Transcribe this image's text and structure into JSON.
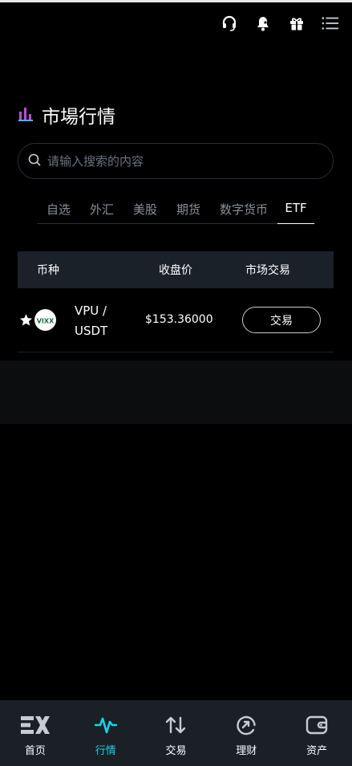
{
  "header": {
    "icons": [
      "headset-icon",
      "bell-icon",
      "gift-icon",
      "menu-icon"
    ]
  },
  "section": {
    "title": "市場行情",
    "icon": "bar-chart-icon"
  },
  "search": {
    "placeholder": "请输入搜索的内容",
    "value": ""
  },
  "tabs": [
    {
      "label": "自选",
      "active": false
    },
    {
      "label": "外汇",
      "active": false
    },
    {
      "label": "美股",
      "active": false
    },
    {
      "label": "期货",
      "active": false
    },
    {
      "label": "数字货币",
      "active": false
    },
    {
      "label": "ETF",
      "active": true
    }
  ],
  "table": {
    "headers": [
      "币种",
      "收盘价",
      "市场交易"
    ],
    "rows": [
      {
        "pair_line1": "VPU /",
        "pair_line2": "USDT",
        "price": "$153.36000",
        "action": "交易",
        "logo_text": "VIXX",
        "favorite": true
      }
    ]
  },
  "nav": {
    "items": [
      {
        "label": "首页",
        "icon": "ex-logo-icon",
        "active": false
      },
      {
        "label": "行情",
        "icon": "pulse-icon",
        "active": true
      },
      {
        "label": "交易",
        "icon": "swap-arrows-icon",
        "active": false
      },
      {
        "label": "理财",
        "icon": "at-circle-icon",
        "active": false
      },
      {
        "label": "资产",
        "icon": "wallet-icon",
        "active": false
      }
    ]
  },
  "colors": {
    "background": "#000000",
    "accent": "#19d3e6",
    "table_header_bg": "#1b2129",
    "nav_bg": "#1b1f26",
    "bar_icon": "#b34fd6"
  }
}
